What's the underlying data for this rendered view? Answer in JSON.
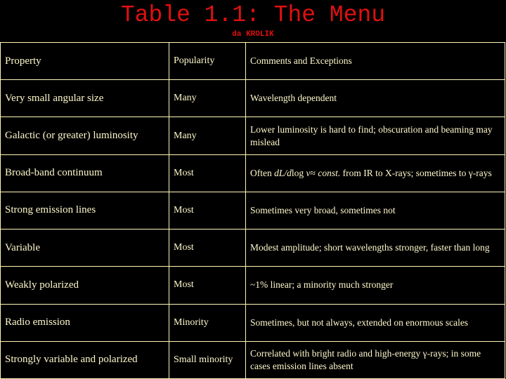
{
  "header": {
    "title": "Table 1.1: The Menu",
    "subtitle": "da KROLIK"
  },
  "colors": {
    "title": "#e01010",
    "text": "#fff8cc",
    "border": "#fff5b8",
    "background": "#000000"
  },
  "table": {
    "columns": [
      "Property",
      "Popularity",
      "Comments and Exceptions"
    ],
    "rows": [
      {
        "property": "Very small angular size",
        "popularity": "Many",
        "comments": "Wavelength dependent"
      },
      {
        "property": "Galactic (or greater) luminosity",
        "popularity": "Many",
        "comments": "Lower luminosity is hard to find; obscuration and beaming may mislead"
      },
      {
        "property": "Broad-band continuum",
        "popularity": "Most",
        "comments_parts": {
          "pre": "Often ",
          "formula": "dL/d",
          "log": "log ",
          "nu": "ν",
          "approx": "≈ ",
          "const": "const.",
          "post": " from IR to X-rays; sometimes to γ-rays"
        }
      },
      {
        "property": "Strong emission lines",
        "popularity": "Most",
        "comments": "Sometimes very broad, sometimes not"
      },
      {
        "property": "Variable",
        "popularity": "Most",
        "comments": "Modest amplitude; short wavelengths stronger, faster than long"
      },
      {
        "property": "Weakly polarized",
        "popularity": "Most",
        "comments": "~1% linear; a minority much stronger"
      },
      {
        "property": "Radio emission",
        "popularity": "Minority",
        "comments": "Sometimes, but not always, extended on enormous scales"
      },
      {
        "property": "Strongly variable and polarized",
        "popularity": "Small minority",
        "comments": "Correlated with bright radio and high-energy γ-rays; in some cases emission lines absent"
      }
    ]
  }
}
